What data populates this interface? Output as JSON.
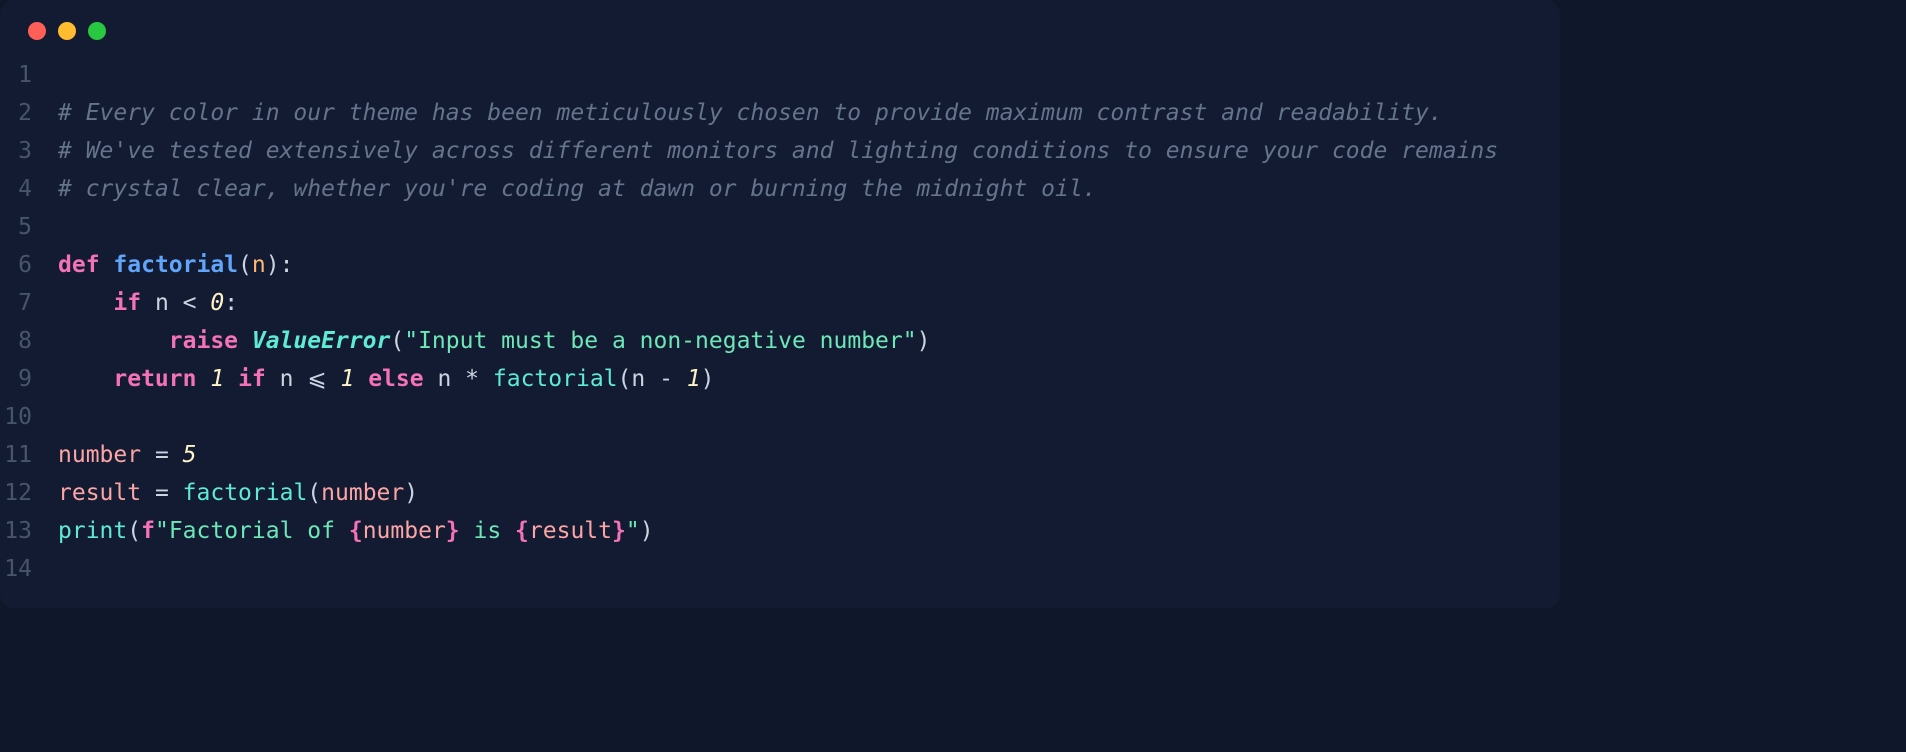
{
  "window": {
    "traffic_lights": [
      "close",
      "minimize",
      "zoom"
    ]
  },
  "line_numbers": [
    "1",
    "2",
    "3",
    "4",
    "5",
    "6",
    "7",
    "8",
    "9",
    "10",
    "11",
    "12",
    "13",
    "14"
  ],
  "tokens": {
    "l2_comment": "# Every color in our theme has been meticulously chosen to provide maximum contrast and readability.",
    "l3_comment": "# We've tested extensively across different monitors and lighting conditions to ensure your code remains",
    "l4_comment": "# crystal clear, whether you're coding at dawn or burning the midnight oil.",
    "l6_def": "def",
    "l6_name": "factorial",
    "l6_lpar": "(",
    "l6_param": "n",
    "l6_rpar_colon": "):",
    "l7_if": "if",
    "l7_n": "n",
    "l7_lt": "<",
    "l7_zero": "0",
    "l7_colon": ":",
    "l8_raise": "raise",
    "l8_err": "ValueError",
    "l8_lpar": "(",
    "l8_str": "\"Input must be a non-negative number\"",
    "l8_rpar": ")",
    "l9_return": "return",
    "l9_one_a": "1",
    "l9_if": "if",
    "l9_n_a": "n",
    "l9_le": "⩽",
    "l9_one_b": "1",
    "l9_else": "else",
    "l9_n_b": "n",
    "l9_mul": "*",
    "l9_call": "factorial",
    "l9_lpar": "(",
    "l9_n_c": "n",
    "l9_minus": "-",
    "l9_one_c": "1",
    "l9_rpar": ")",
    "l11_var": "number",
    "l11_eq": "=",
    "l11_val": "5",
    "l12_var": "result",
    "l12_eq": "=",
    "l12_call": "factorial",
    "l12_lpar": "(",
    "l12_arg": "number",
    "l12_rpar": ")",
    "l13_print": "print",
    "l13_lpar": "(",
    "l13_f": "f",
    "l13_s1": "\"Factorial of ",
    "l13_lb1": "{",
    "l13_v1": "number",
    "l13_rb1": "}",
    "l13_s2": " is ",
    "l13_lb2": "{",
    "l13_v2": "result",
    "l13_rb2": "}",
    "l13_s3": "\"",
    "l13_rpar": ")"
  }
}
